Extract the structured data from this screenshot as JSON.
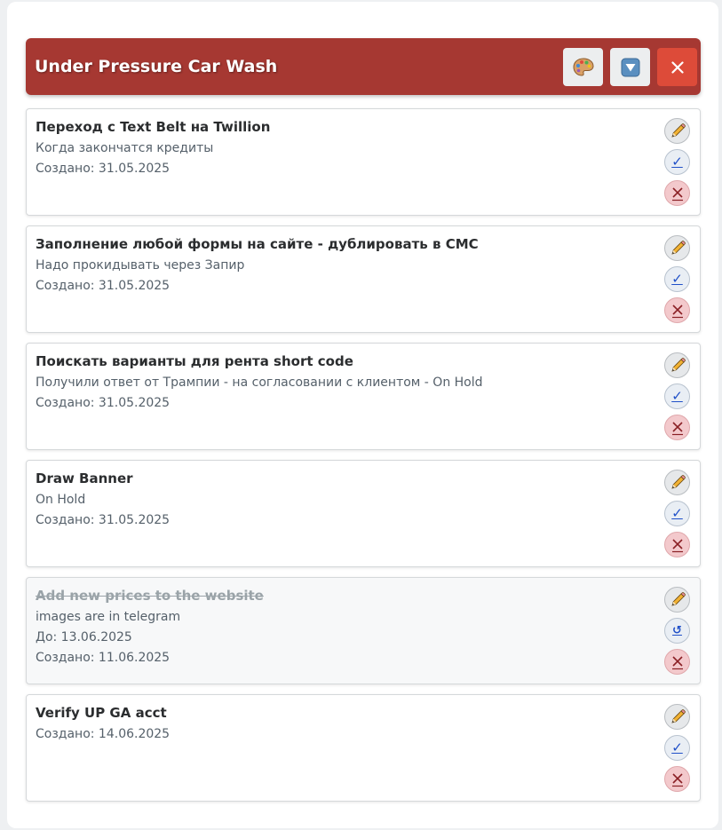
{
  "header": {
    "title": "Under Pressure Car Wash",
    "buttons": {
      "palette_icon": "palette-icon",
      "filter_icon": "filter-triangle-icon",
      "close_icon": "close-icon",
      "close_color": "#dd4b39"
    },
    "accent": "#a63832"
  },
  "tasks": [
    {
      "title": "Переход с Text Belt на Twillion",
      "description": "Когда закончатся кредиты",
      "created": "Создано: 31.05.2025",
      "completed": false
    },
    {
      "title": "Заполнение любой формы на сайте - дублировать в СМС",
      "description": "Надо прокидывать через Запир",
      "created": "Создано: 31.05.2025",
      "completed": false
    },
    {
      "title": "Поискать варианты для рента short code",
      "description": "Получили ответ от Трампии - на согласовании с клиентом - On Hold",
      "created": "Создано: 31.05.2025",
      "completed": false
    },
    {
      "title": "Draw Banner",
      "description": "On Hold",
      "created": "Создано: 31.05.2025",
      "completed": false
    },
    {
      "title": "Add new prices to the website",
      "description": "images are in telegram",
      "due": "До: 13.06.2025",
      "created": "Создано: 11.06.2025",
      "completed": true
    },
    {
      "title": "Verify UP GA acct",
      "created": "Создано: 14.06.2025",
      "completed": false
    }
  ],
  "actions": {
    "edit_icon": "pencil-icon",
    "complete_icon": "checkmark-icon",
    "undo_icon": "undo-icon",
    "delete_icon": "delete-x-icon",
    "delete_color": "#f3c9cc"
  }
}
